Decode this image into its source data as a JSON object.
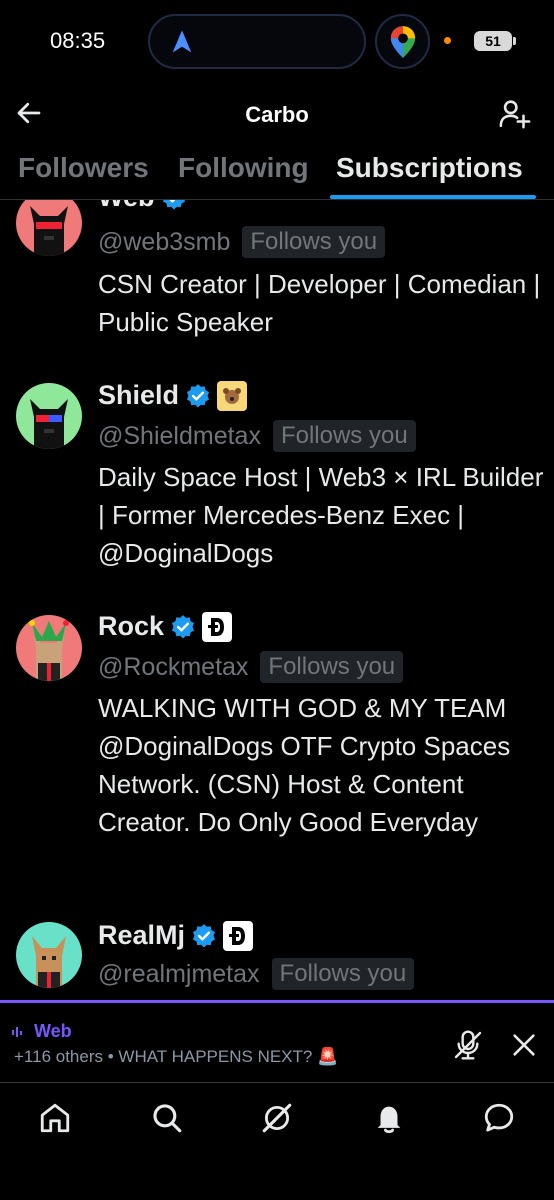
{
  "status_bar": {
    "time": "08:35",
    "battery": "51"
  },
  "header": {
    "title": "Carbo"
  },
  "tabs": [
    {
      "label": "Followers",
      "active": false
    },
    {
      "label": "Following",
      "active": false
    },
    {
      "label": "Subscriptions",
      "active": true
    }
  ],
  "users": [
    {
      "name": "Web",
      "handle": "@web3smb",
      "follows_you": "Follows you",
      "bio": "CSN Creator | Developer | Comedian | Public Speaker",
      "verified": true,
      "affiliate_badge": "none"
    },
    {
      "name": "Shield",
      "handle": "@Shieldmetax",
      "follows_you": "Follows you",
      "bio": "Daily Space Host | Web3 × IRL Builder | Former Mercedes-Benz Exec | @DoginalDogs",
      "verified": true,
      "affiliate_badge": "dog-emoji"
    },
    {
      "name": "Rock",
      "handle": "@Rockmetax",
      "follows_you": "Follows you",
      "bio": "WALKING WITH GOD & MY TEAM @DoginalDogs OTF Crypto Spaces Network. (CSN) Host & Content Creator. Do Only Good Everyday",
      "verified": true,
      "affiliate_badge": "doginal-logo"
    },
    {
      "name": "RealMj",
      "handle": "@realmjmetax",
      "follows_you": "Follows you",
      "bio": "",
      "verified": true,
      "affiliate_badge": "doginal-logo"
    }
  ],
  "space_bar": {
    "title": "Web",
    "subtitle": "+116 others • WHAT HAPPENS NEXT? 🚨"
  },
  "colors": {
    "accent": "#1d9bf0",
    "spaces_purple": "#7856ff",
    "muted_text": "#71767b",
    "background": "#000000"
  },
  "bottom_nav": [
    "home-icon",
    "search-icon",
    "grok-icon",
    "notifications-icon",
    "messages-icon"
  ]
}
